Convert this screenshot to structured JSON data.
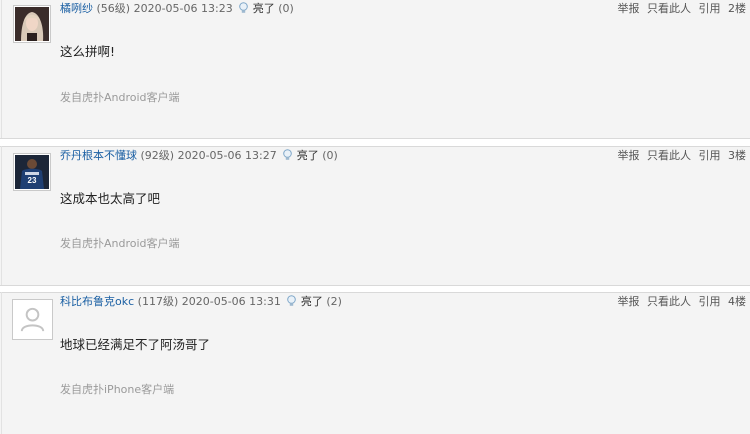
{
  "posts": [
    {
      "username": "橘咧纱",
      "level": "(56级)",
      "time": "2020-05-06 13:23",
      "like_label": "亮了",
      "like_count": "(0)",
      "content": "这么拼啊!",
      "source": "发自虎扑Android客户端",
      "actions": {
        "report": "举报",
        "only_this": "只看此人",
        "quote": "引用"
      },
      "floor": "2楼"
    },
    {
      "username": "乔丹根本不懂球",
      "level": "(92级)",
      "time": "2020-05-06 13:27",
      "like_label": "亮了",
      "like_count": "(0)",
      "content": "这成本也太高了吧",
      "source": "发自虎扑Android客户端",
      "actions": {
        "report": "举报",
        "only_this": "只看此人",
        "quote": "引用"
      },
      "floor": "3楼"
    },
    {
      "username": "科比布鲁克okc",
      "level": "(117级)",
      "time": "2020-05-06 13:31",
      "like_label": "亮了",
      "like_count": "(2)",
      "content": "地球已经满足不了阿汤哥了",
      "source": "发自虎扑iPhone客户端",
      "actions": {
        "report": "举报",
        "only_this": "只看此人",
        "quote": "引用"
      },
      "floor": "4楼"
    }
  ],
  "icons": {
    "like": "lightbulb-icon",
    "default_avatar": "user-silhouette-icon"
  },
  "colors": {
    "username": "#1a5fa3",
    "post_bg": "#f4f4f4",
    "source_text": "#9a9a9a"
  }
}
